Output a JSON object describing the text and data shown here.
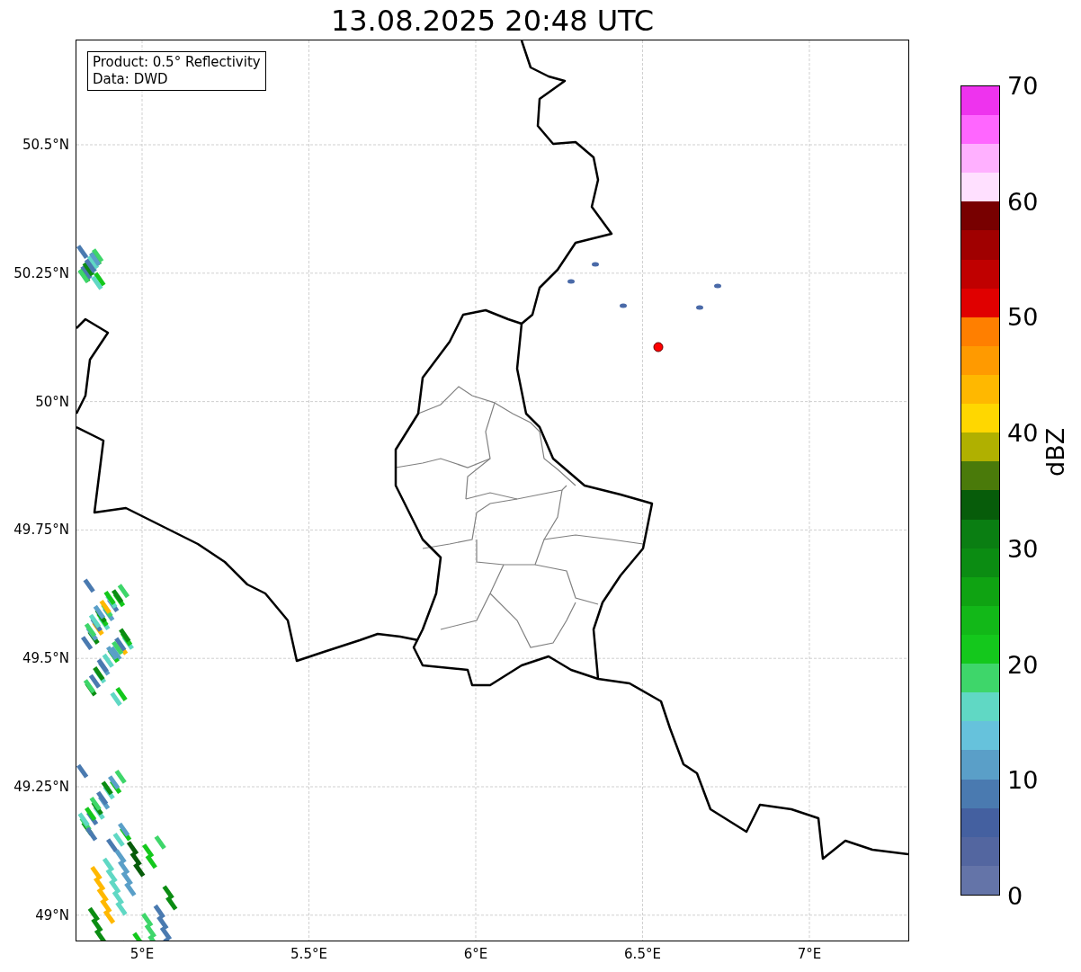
{
  "title": "13.08.2025 20:48 UTC",
  "info_box": [
    "Product: 0.5° Reflectivity",
    "Data: DWD"
  ],
  "map": {
    "x_ticks": [
      "5°E",
      "5.5°E",
      "6°E",
      "6.5°E",
      "7°E"
    ],
    "y_ticks": [
      "50.5°N",
      "50.25°N",
      "50°N",
      "49.75°N",
      "49.5°N",
      "49.25°N",
      "49°N"
    ]
  },
  "colorbar": {
    "label": "dBZ",
    "ticks": [
      "70",
      "60",
      "50",
      "40",
      "30",
      "20",
      "10",
      "0"
    ],
    "bands": [
      {
        "color": "#6474a8"
      },
      {
        "color": "#5366a0"
      },
      {
        "color": "#4460a0"
      },
      {
        "color": "#4a7ab0"
      },
      {
        "color": "#5a9fc8"
      },
      {
        "color": "#66c2dc"
      },
      {
        "color": "#60d8c4"
      },
      {
        "color": "#3ed66a"
      },
      {
        "color": "#14c81c"
      },
      {
        "color": "#12b818"
      },
      {
        "color": "#0fa312"
      },
      {
        "color": "#0b8c12"
      },
      {
        "color": "#0a7e12"
      },
      {
        "color": "#075c0a"
      },
      {
        "color": "#4a7a0a"
      },
      {
        "color": "#b0b000"
      },
      {
        "color": "#ffd700"
      },
      {
        "color": "#ffb800"
      },
      {
        "color": "#ff9a00"
      },
      {
        "color": "#ff7f00"
      },
      {
        "color": "#e00000"
      },
      {
        "color": "#c00000"
      },
      {
        "color": "#a00000"
      },
      {
        "color": "#780000"
      },
      {
        "color": "#ffe0ff"
      },
      {
        "color": "#ffb0ff"
      },
      {
        "color": "#ff66ff"
      },
      {
        "color": "#ee33ee"
      }
    ]
  }
}
